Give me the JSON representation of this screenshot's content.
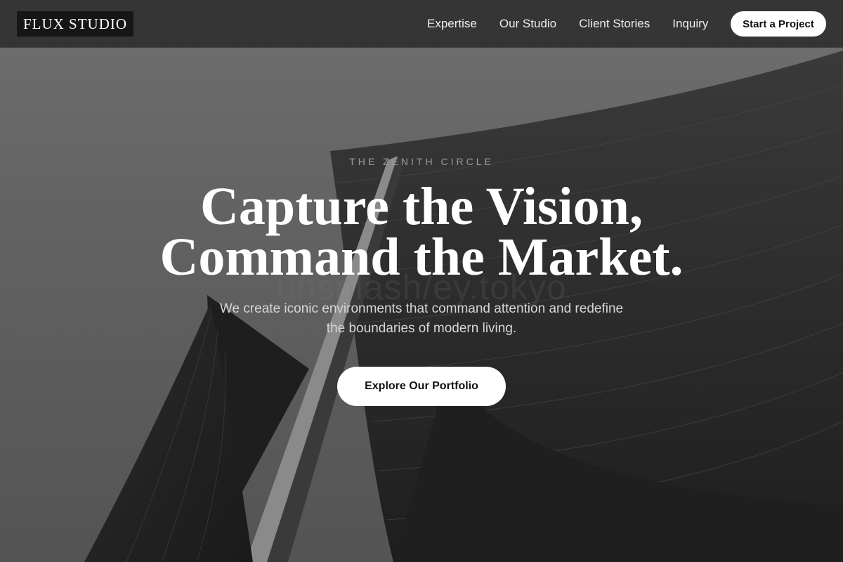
{
  "brand": {
    "logo": "FLUX STUDIO"
  },
  "nav": {
    "links": [
      "Expertise",
      "Our Studio",
      "Client Stories",
      "Inquiry"
    ],
    "cta": "Start a Project"
  },
  "hero": {
    "eyebrow": "THE ZENITH CIRCLE",
    "headline_line1": "Capture the Vision,",
    "headline_line2": "Command the Market.",
    "subtext_line1": "We create iconic environments that command attention and redefine",
    "subtext_line2": "the boundaries of modern living.",
    "button": "Explore Our Portfolio",
    "watermark": "unsplash/ey.tokyo",
    "image": "architecture-photo"
  },
  "colors": {
    "nav_bg": "#2a2a2a",
    "logo_bg": "#161616",
    "button_bg": "#ffffff",
    "text_primary": "#ffffff"
  }
}
